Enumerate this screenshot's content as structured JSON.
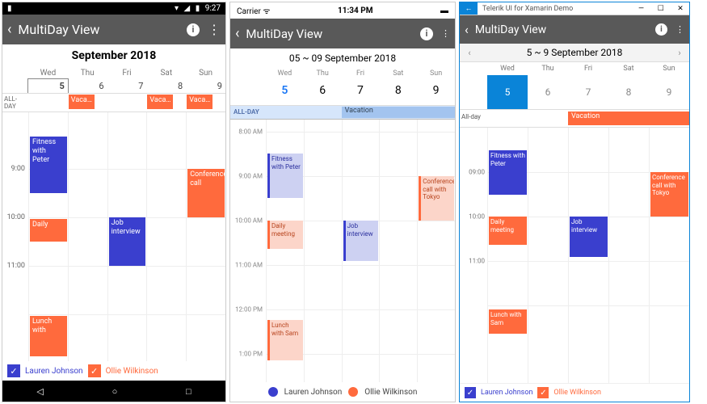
{
  "header_title": "MultiDay View",
  "android": {
    "status_time": "9:27",
    "month": "September 2018",
    "weekdays": [
      "Wed",
      "Thu",
      "Fri",
      "Sat",
      "Sun"
    ],
    "dates": [
      "5",
      "6",
      "7",
      "8",
      "9"
    ],
    "allday_label": "ALL-DAY",
    "allday_events": {
      "thu": "Vaca…",
      "sat": "Vaca…",
      "sun": "Vaca…"
    },
    "time_labels": [
      "9:00",
      "10:00",
      "11:00"
    ],
    "events": {
      "fitness": "Fitness with Peter",
      "daily": "Daily",
      "job": "Job interview",
      "conf": "Conference call",
      "lunch": "Lunch with"
    },
    "legend": {
      "a": "Lauren Johnson",
      "b": "Ollie Wilkinson"
    }
  },
  "ios": {
    "carrier": "Carrier",
    "time": "11:34 PM",
    "range": "05 ~ 09 September 2018",
    "weekdays": [
      "Wed",
      "Thu",
      "Fri",
      "Sat",
      "Sun"
    ],
    "dates": [
      "5",
      "6",
      "7",
      "8",
      "9"
    ],
    "allday_label": "ALL-DAY",
    "vacation": "Vacation",
    "time_labels": [
      "8:00 AM",
      "9:00 AM",
      "10:00 AM",
      "11:00 AM",
      "12:00 PM",
      "1:00 PM"
    ],
    "events": {
      "fitness": "Fitness with Peter",
      "daily": "Daily meeting",
      "job": "Job interview",
      "conf": "Conference call with Tokyo",
      "lunch": "Lunch with Sam"
    },
    "legend": {
      "a": "Lauren Johnson",
      "b": "Ollie Wilkinson"
    }
  },
  "win": {
    "window_title": "Telerik UI for Xamarin Demo",
    "range": "5  ~ 9 September 2018",
    "weekdays": [
      "Wed",
      "Thu",
      "Fri",
      "Sat",
      "Sun"
    ],
    "dates": [
      "5",
      "6",
      "7",
      "8",
      "9"
    ],
    "allday_label": "All-day",
    "vacation": "Vacation",
    "time_labels": [
      "09:00",
      "10:00",
      "11:00"
    ],
    "events": {
      "fitness": "Fitness with Peter",
      "daily": "Daily meeting",
      "job": "Job interview",
      "conf": "Conference call with Tokyo",
      "lunch": "Lunch with Sam"
    },
    "legend": {
      "a": "Lauren Johnson",
      "b": "Ollie Wilkinson"
    }
  },
  "colors": {
    "blue": "#3a3fce",
    "orange": "#ff6a3d",
    "ios_accent": "#1976f5",
    "win_accent": "#0a84d8"
  }
}
